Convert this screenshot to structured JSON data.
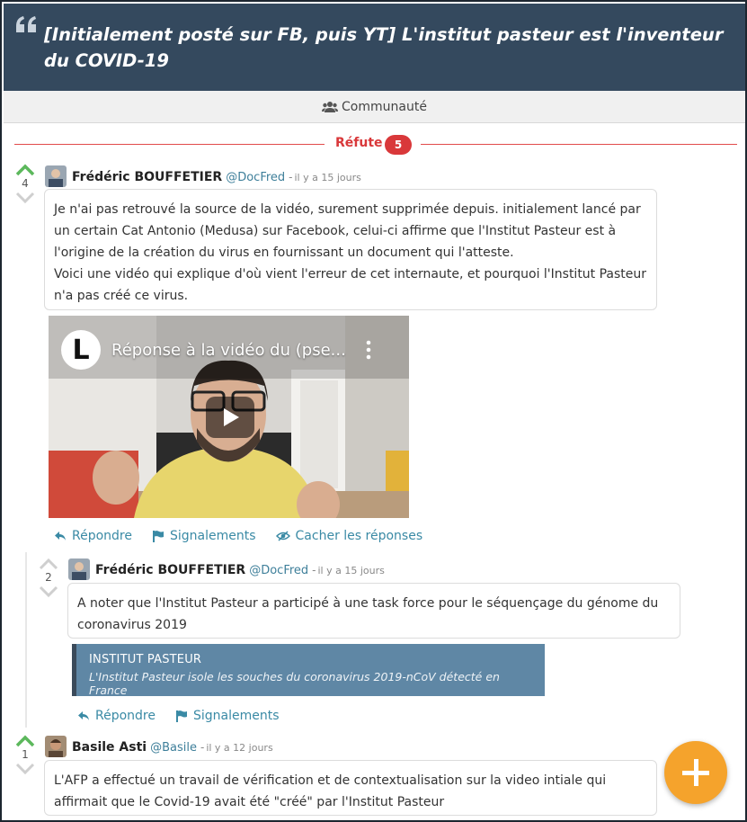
{
  "question": {
    "title": "[Initialement posté sur FB, puis YT] L'institut pasteur est l'inventeur du COVID-19"
  },
  "community_tab": {
    "label": "Communauté"
  },
  "section": {
    "label": "Réfute",
    "count": "5"
  },
  "colors": {
    "header_bg": "#34495e",
    "refute_red": "#d9383a",
    "link_teal": "#3a8aa5",
    "upvote_green": "#5cb85c",
    "fab_orange": "#f5a32c"
  },
  "comments": [
    {
      "author": "Frédéric BOUFFETIER",
      "handle": "@DocFred",
      "separator": "-",
      "time": "il y a 15 jours",
      "votes": "4",
      "text_lines": [
        "Je n'ai pas retrouvé la source de la vidéo, surement supprimée depuis. initialement lancé par",
        "un certain Cat Antonio (Medusa) sur Facebook, celui-ci affirme que l'Institut Pasteur est à",
        "l'origine de la création du virus en fournissant un document qui l'atteste.",
        "Voici une vidéo qui explique d'où vient l'erreur de cet internaute, et pourquoi l'Institut Pasteur",
        "n'a pas créé ce virus."
      ],
      "video": {
        "title": "Réponse à la vidéo du (pse...",
        "channel_initial": "L"
      },
      "actions": {
        "reply": "Répondre",
        "report": "Signalements",
        "hide": "Cacher les réponses"
      }
    },
    {
      "author": "Frédéric BOUFFETIER",
      "handle": "@DocFred",
      "separator": "-",
      "time": "il y a 15 jours",
      "votes": "2",
      "text_lines": [
        "A noter que l'Institut Pasteur a participé à une task force pour le séquençage du génome du",
        "coronavirus 2019"
      ],
      "link_card": {
        "title": "INSTITUT PASTEUR",
        "description": "L'Institut Pasteur isole les souches du coronavirus 2019-nCoV détecté en France"
      },
      "actions": {
        "reply": "Répondre",
        "report": "Signalements"
      }
    },
    {
      "author": "Basile Asti",
      "handle": "@Basile",
      "separator": "-",
      "time": "il y a 12 jours",
      "votes": "1",
      "text_lines": [
        "L'AFP a effectué un travail de vérification et de contextualisation sur la video intiale qui",
        "affirmait que le Covid-19 avait été \"créé\" par l'Institut Pasteur"
      ]
    }
  ],
  "icons": {
    "quote": "quote-icon",
    "users": "users-icon",
    "upvote": "chevron-up-icon",
    "downvote": "chevron-down-icon",
    "reply": "reply-icon",
    "report": "flag-icon",
    "hide": "eye-slash-icon",
    "play": "play-icon",
    "add": "plus-icon"
  }
}
